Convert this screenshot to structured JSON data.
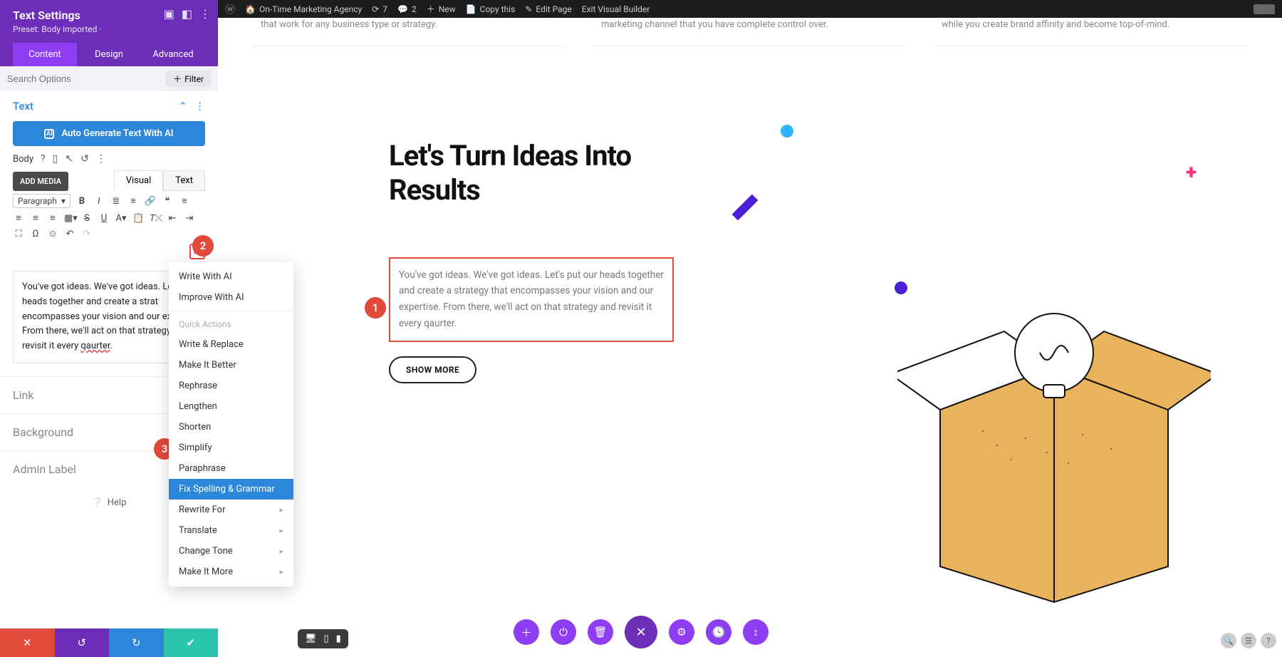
{
  "adminbar": {
    "site": "On-Time Marketing Agency",
    "updates": "7",
    "comments": "2",
    "new": "New",
    "copy": "Copy this",
    "edit": "Edit Page",
    "exit": "Exit Visual Builder"
  },
  "panel": {
    "title": "Text Settings",
    "preset": "Preset: Body imported ·",
    "tabs": {
      "content": "Content",
      "design": "Design",
      "advanced": "Advanced"
    },
    "search_placeholder": "Search Options",
    "filter": "Filter",
    "section_text": "Text",
    "ai_btn": "Auto Generate Text With AI",
    "body_label": "Body",
    "add_media": "ADD MEDIA",
    "editor_tabs": {
      "visual": "Visual",
      "text": "Text"
    },
    "paragraph": "Paragraph",
    "ai_square": "AI",
    "editor_body_a": "You've got ideas. We've got ideas. Let our heads together and create a strat encompasses your vision and our exp From there, we'll act on that strategy revisit it every ",
    "editor_body_typo": "qaurter",
    "editor_body_end": ".",
    "sections": {
      "link": "Link",
      "background": "Background",
      "admin_label": "Admin Label"
    },
    "help": "Help"
  },
  "ai_menu": {
    "write": "Write With AI",
    "improve": "Improve With AI",
    "quick": "Quick Actions",
    "items": [
      "Write & Replace",
      "Make It Better",
      "Rephrase",
      "Lengthen",
      "Shorten",
      "Simplify",
      "Paraphrase",
      "Fix Spelling & Grammar",
      "Rewrite For",
      "Translate",
      "Change Tone",
      "Make It More"
    ],
    "active_index": 7,
    "submenu_from": 8
  },
  "canvas": {
    "top_cards": [
      "that work for any business type or strategy.",
      "marketing channel that you have complete control over.",
      "while you create brand affinity and become top-of-mind."
    ],
    "hero_title": "Let's Turn Ideas Into Results",
    "hero_para": "You've got ideas. We've got ideas. Let's put our heads together and create a strategy that encompasses your vision and our expertise. From there, we'll act on that strategy and revisit it every qaurter.",
    "show_more": "SHOW MORE"
  },
  "callouts": {
    "c1": "1",
    "c2": "2",
    "c3": "3"
  }
}
